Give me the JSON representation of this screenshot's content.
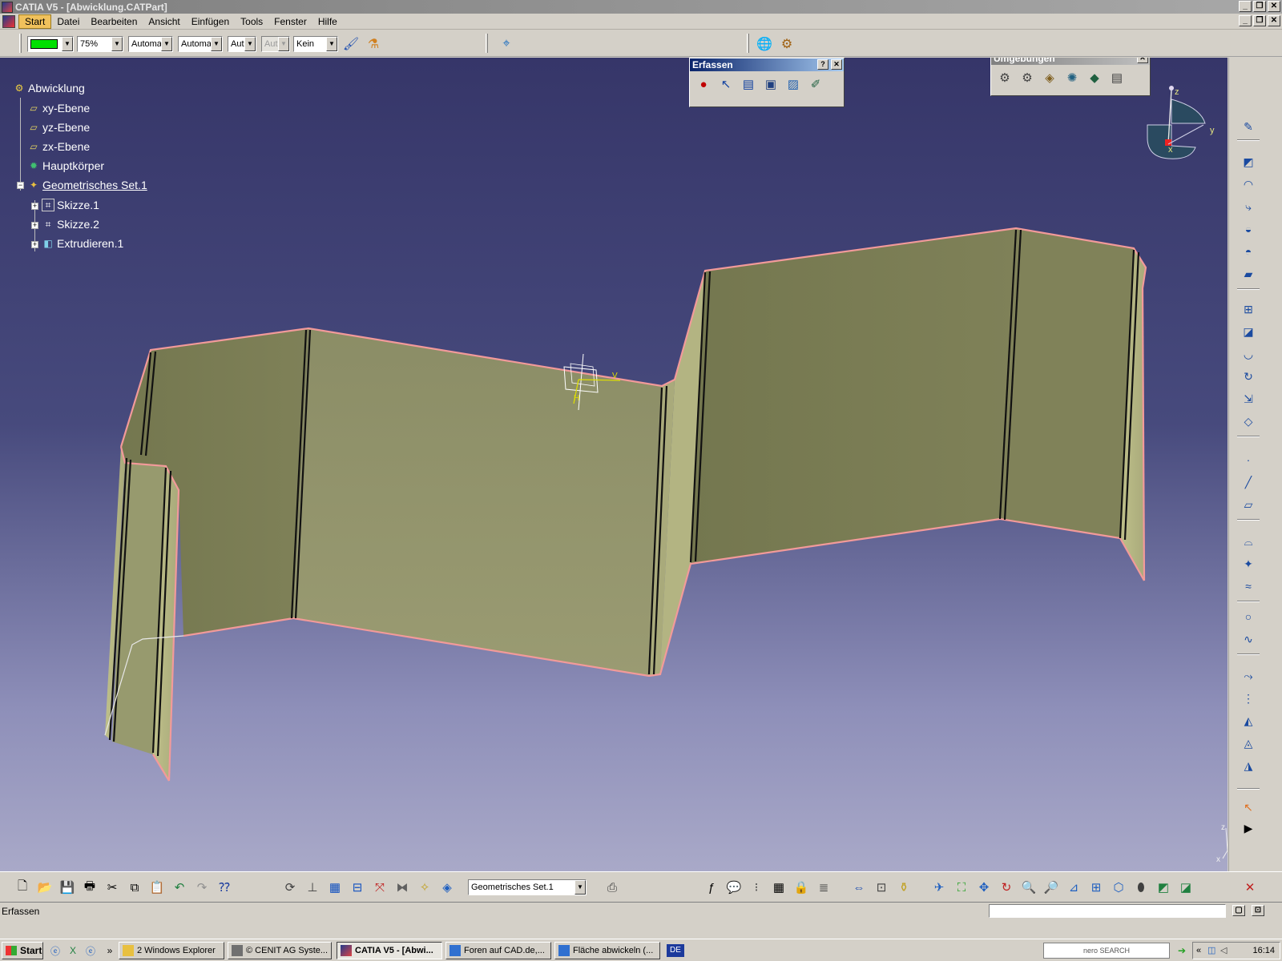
{
  "window": {
    "title": "CATIA V5 - [Abwicklung.CATPart]"
  },
  "menu": {
    "items": [
      {
        "label": "Start"
      },
      {
        "label": "Datei"
      },
      {
        "label": "Bearbeiten"
      },
      {
        "label": "Ansicht"
      },
      {
        "label": "Einfügen"
      },
      {
        "label": "Tools"
      },
      {
        "label": "Fenster"
      },
      {
        "label": "Hilfe"
      }
    ]
  },
  "toolbar_top": {
    "color_value": "#00e000",
    "transparency": "75%",
    "line_thickness": "Automa",
    "line_type": "Automa",
    "point_type": "Aut",
    "layer_disabled": "Aut",
    "render_style": "Kein"
  },
  "spec_tree": {
    "root": "Abwicklung",
    "items": [
      {
        "label": "xy-Ebene"
      },
      {
        "label": "yz-Ebene"
      },
      {
        "label": "zx-Ebene"
      },
      {
        "label": "Hauptkörper"
      },
      {
        "label": "Geometrisches Set.1"
      },
      {
        "label": "Skizze.1"
      },
      {
        "label": "Skizze.2"
      },
      {
        "label": "Extrudieren.1"
      }
    ]
  },
  "erfassen_toolbar": {
    "title": "Erfassen",
    "help": "?",
    "close": "✕"
  },
  "umgebungen_toolbar": {
    "title": "Umgebungen",
    "close": "✕"
  },
  "compass": {
    "x": "x",
    "y": "y",
    "z": "z"
  },
  "axis_mini": {
    "x": "x",
    "y": "y",
    "z": "z"
  },
  "origin_labels": {
    "v": "V",
    "h": "H"
  },
  "toolbar_bottom": {
    "current_set": "Geometrisches Set.1"
  },
  "statusbar": {
    "message": "Erfassen"
  },
  "taskbar": {
    "start": "Start",
    "more": "»",
    "tasks": [
      {
        "label": "2 Windows Explorer"
      },
      {
        "label": "© CENIT AG Syste..."
      },
      {
        "label": "CATIA V5 - [Abwi..."
      },
      {
        "label": "Foren auf CAD.de,..."
      },
      {
        "label": "Fläche abwickeln (..."
      }
    ],
    "language": "DE",
    "search": "nero SEARCH",
    "tray_arrow": "«",
    "clock": "16:14"
  },
  "colors": {
    "surface_dark": "#7d7f58",
    "surface_mid": "#8a8c66",
    "surface_light": "#b8b883",
    "edge_highlight": "#f29a9a",
    "background_top": "#363669",
    "background_bottom": "#a9a9c8"
  }
}
